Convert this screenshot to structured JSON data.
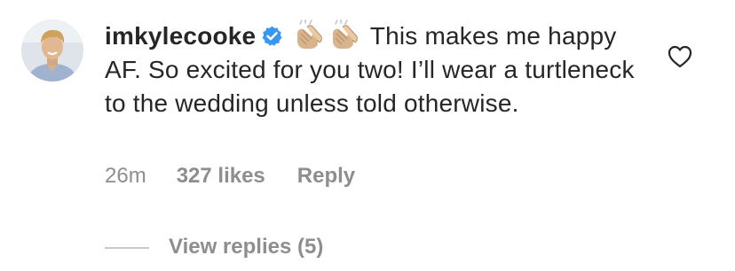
{
  "comment": {
    "username": "imkylecooke",
    "avatar_icon": "avatar-photo",
    "verified_icon": "verified-badge-icon",
    "emoji": [
      "clapping-hands-emoji",
      "clapping-hands-emoji"
    ],
    "text": "This makes me happy AF. So excited for you two! I’ll wear a turtleneck to the wedding unless told otherwise.",
    "time": "26m",
    "likes": "327 likes",
    "reply_label": "Reply",
    "like_icon": "heart-outline-icon",
    "view_replies": "View replies (5)"
  },
  "colors": {
    "text": "#262626",
    "secondary": "#8e8e8e",
    "verified": "#3897f0",
    "divider": "#c7c7c7"
  }
}
